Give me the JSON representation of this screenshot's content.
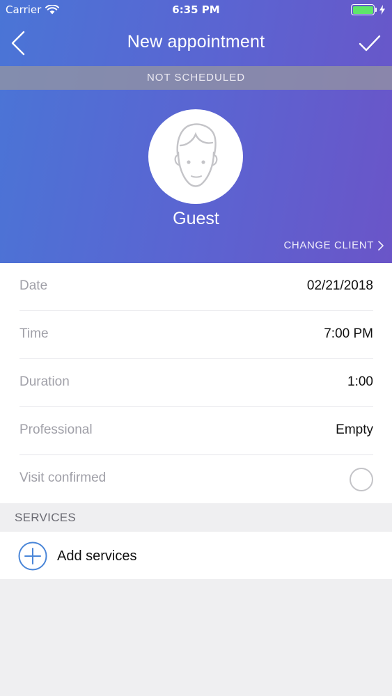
{
  "status_bar": {
    "carrier": "Carrier",
    "time": "6:35 PM"
  },
  "nav": {
    "title": "New appointment"
  },
  "banner": {
    "status": "NOT SCHEDULED"
  },
  "client": {
    "name": "Guest",
    "change_label": "CHANGE CLIENT"
  },
  "details": {
    "date": {
      "label": "Date",
      "value": "02/21/2018"
    },
    "time": {
      "label": "Time",
      "value": "7:00 PM"
    },
    "duration": {
      "label": "Duration",
      "value": "1:00"
    },
    "professional": {
      "label": "Professional",
      "value": "Empty"
    },
    "visit_confirmed": {
      "label": "Visit confirmed",
      "checked": false
    }
  },
  "services": {
    "section_title": "SERVICES",
    "add_label": "Add services"
  },
  "colors": {
    "accent": "#4a86d8",
    "header_start": "#4a75d6",
    "header_end": "#6a55c8"
  }
}
